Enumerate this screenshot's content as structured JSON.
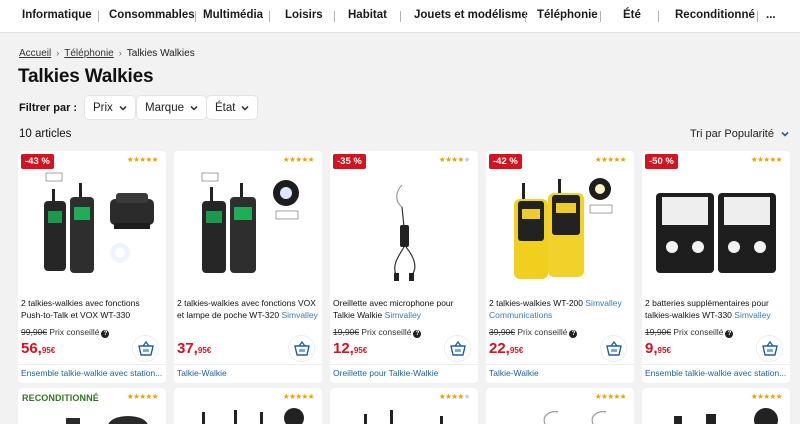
{
  "nav": {
    "items": [
      "Informatique",
      "Consommables",
      "Multimédia",
      "Loisirs",
      "Habitat",
      "Jouets et modélisme",
      "Téléphonie",
      "Été",
      "Reconditionné",
      "..."
    ]
  },
  "breadcrumb": {
    "items": [
      "Accueil",
      "Téléphonie",
      "Talkies Walkies"
    ]
  },
  "page": {
    "title": "Talkies Walkies",
    "filter_label": "Filtrer par :",
    "filters": [
      "Prix",
      "Marque",
      "État"
    ],
    "count": "10 articles",
    "sort_label": "Tri par Popularité"
  },
  "colors": {
    "discount_badge": "#d5121f",
    "price": "#d5121f",
    "link": "#1f5f9f",
    "brand_text": "#3c7bb0",
    "reconditioned": "#2d7a22",
    "stars": "#e8a100"
  },
  "products": [
    {
      "badge": "-43 %",
      "rating": 5,
      "image": "walkie-talkie-pair-with-charger",
      "title": "2 talkies-walkies avec fonctions Push-to-Talk et VOX WT-330",
      "brand": "",
      "old_price": "99,90€",
      "old_label": "Prix conseillé",
      "price_int": "56,",
      "price_dec": "95€",
      "category": "Ensemble talkie-walkie avec station..."
    },
    {
      "badge": "",
      "rating": 5,
      "image": "walkie-talkie-pair-with-flashlight",
      "title": "2 talkies-walkies avec fonctions VOX et lampe de poche WT-320",
      "brand": "Simvalley",
      "old_price": "",
      "old_label": "",
      "price_int": "37,",
      "price_dec": "95€",
      "category": "Talkie-Walkie"
    },
    {
      "badge": "-35 %",
      "rating": 4,
      "image": "earpiece-with-microphone",
      "title": "Oreillette avec microphone pour Talkie Walkie",
      "brand": "Simvalley",
      "old_price": "19,90€",
      "old_label": "Prix conseillé",
      "price_int": "12,",
      "price_dec": "95€",
      "category": "Oreillette pour Talkie-Walkie"
    },
    {
      "badge": "-42 %",
      "rating": 5,
      "image": "yellow-walkie-talkie-pair",
      "title": "2 talkies-walkies WT-200",
      "brand": "Simvalley Communications",
      "old_price": "39,90€",
      "old_label": "Prix conseillé",
      "price_int": "22,",
      "price_dec": "95€",
      "category": "Talkie-Walkie"
    },
    {
      "badge": "-50 %",
      "rating": 5,
      "image": "battery-pair",
      "title": "2 batteries supplémentaires pour talkies-walkies WT-330",
      "brand": "Simvalley",
      "old_price": "19,90€",
      "old_label": "Prix conseillé",
      "price_int": "9,",
      "price_dec": "95€",
      "category": "Ensemble talkie-walkie avec station..."
    }
  ],
  "row2": [
    {
      "badge_text": "RECONDITIONNÉ",
      "rating": 5
    },
    {
      "badge_text": "",
      "rating": 5
    },
    {
      "badge_text": "",
      "rating": 4
    },
    {
      "badge_text": "",
      "rating": 5
    },
    {
      "badge_text": "",
      "rating": 5
    }
  ]
}
